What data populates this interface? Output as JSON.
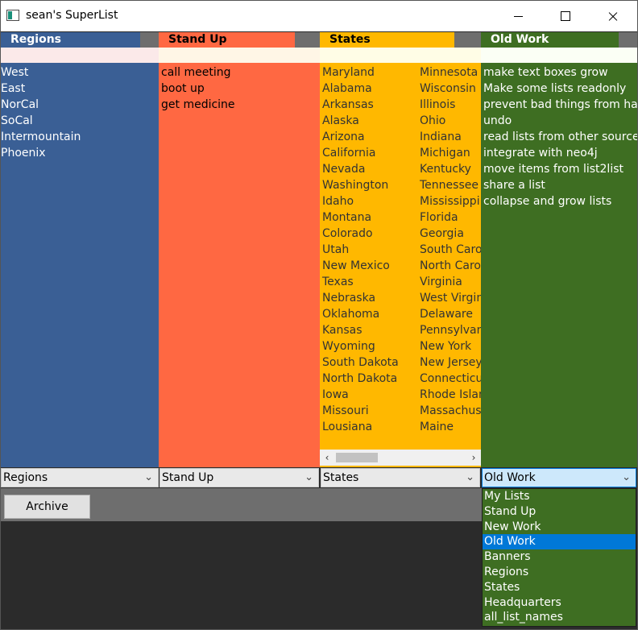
{
  "window": {
    "title": "sean's SuperList"
  },
  "columns": [
    {
      "header": "Regions",
      "items": [
        "West",
        "East",
        "NorCal",
        "SoCal",
        "Intermountain",
        "Phoenix"
      ]
    },
    {
      "header": "Stand Up",
      "items": [
        "call meeting",
        "boot up",
        "get medicine"
      ]
    },
    {
      "header": "States",
      "items": [
        "Maryland",
        "Alabama",
        "Arkansas",
        "Alaska",
        "Arizona",
        "California",
        "Nevada",
        "Washington",
        "Idaho",
        "Montana",
        "Colorado",
        "Utah",
        "New Mexico",
        "Texas",
        "Nebraska",
        "Oklahoma",
        "Kansas",
        "Wyoming",
        "South Dakota",
        "North Dakota",
        "Iowa",
        "Missouri",
        "Lousiana"
      ],
      "items2": [
        "Minnesota",
        "Wisconsin",
        "Illinois",
        "Ohio",
        "Indiana",
        "Michigan",
        "Kentucky",
        "Tennessee",
        "Mississippi",
        "Florida",
        "Georgia",
        "South Carol",
        "North Carol",
        "Virginia",
        "West Virgin",
        "Delaware",
        "Pennsylvan",
        "New York",
        "New Jersey",
        "Connecticu",
        "Rhode Islan",
        "Massachuse",
        "Maine"
      ]
    },
    {
      "header": "Old Work",
      "items": [
        "make text boxes grow",
        "Make some lists readonly",
        "prevent bad things from happ",
        "undo",
        "read lists from other sources",
        "integrate with neo4j",
        "move items from list2list",
        "share a list",
        "collapse and grow lists"
      ]
    }
  ],
  "selectors": [
    "Regions",
    "Stand Up",
    "States",
    "Old Work"
  ],
  "archive_label": "Archive",
  "dropdown": {
    "options": [
      "My Lists",
      "Stand Up",
      "New Work",
      "Old Work",
      "Banners",
      "Regions",
      "States",
      "Headquarters",
      "all_list_names"
    ],
    "selected": "Old Work"
  },
  "colors": {
    "regions": "#3a5f95",
    "standup": "#ff6842",
    "states": "#ffb800",
    "oldwork": "#3e6e22",
    "highlight": "#0078d7"
  }
}
